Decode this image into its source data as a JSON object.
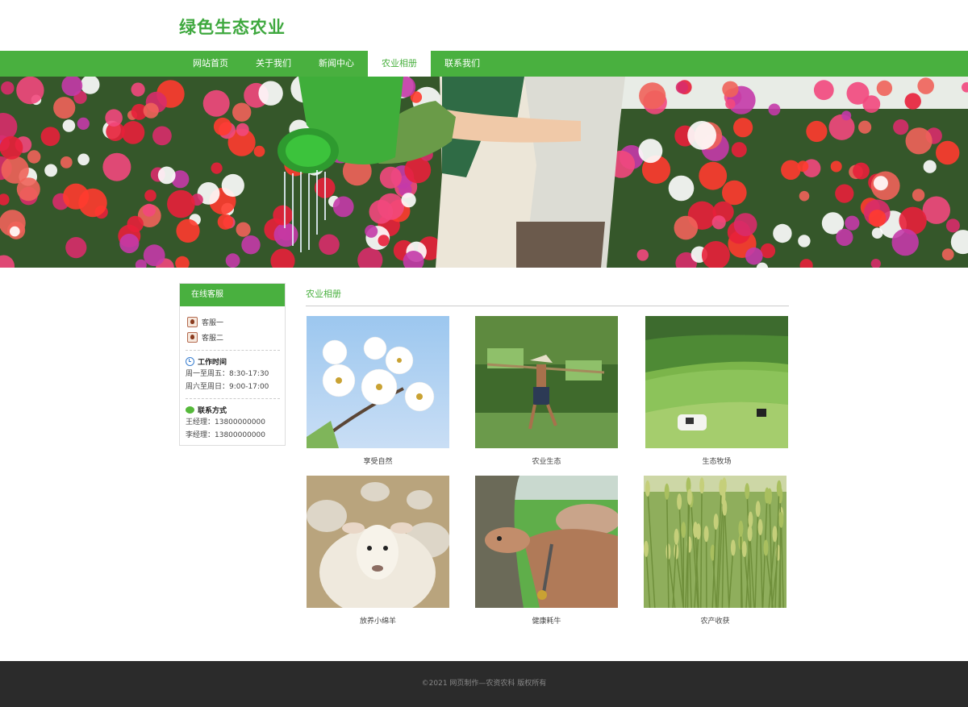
{
  "site": {
    "title": "绿色生态农业"
  },
  "nav": {
    "items": [
      {
        "label": "网站首页"
      },
      {
        "label": "关于我们"
      },
      {
        "label": "新闻中心"
      },
      {
        "label": "农业相册"
      },
      {
        "label": "联系我们"
      }
    ],
    "active": "农业相册"
  },
  "sidebar": {
    "heading": "在线客服",
    "service": [
      {
        "label": "客服一"
      },
      {
        "label": "客服二"
      }
    ],
    "hours_title": "工作时间",
    "hours": [
      "周一至周五：8:30-17:30",
      "周六至周日：9:00-17:00"
    ],
    "contact_title": "联系方式",
    "contacts": [
      "王经理：13800000000",
      "李经理：13800000000"
    ]
  },
  "main": {
    "title": "农业相册",
    "photos": [
      {
        "caption": "享受自然",
        "icon": "pear-blossom"
      },
      {
        "caption": "农业生态",
        "icon": "rice-farmer"
      },
      {
        "caption": "生态牧场",
        "icon": "pasture"
      },
      {
        "caption": "放养小绵羊",
        "icon": "sheep"
      },
      {
        "caption": "健康耗牛",
        "icon": "calf"
      },
      {
        "caption": "农产收获",
        "icon": "wheat"
      }
    ]
  },
  "footer": {
    "text": "©2021 网页制作—农资农科 版权所有"
  },
  "colors": {
    "brand_green": "#49b03f",
    "footer_bg": "#2b2b2b"
  }
}
